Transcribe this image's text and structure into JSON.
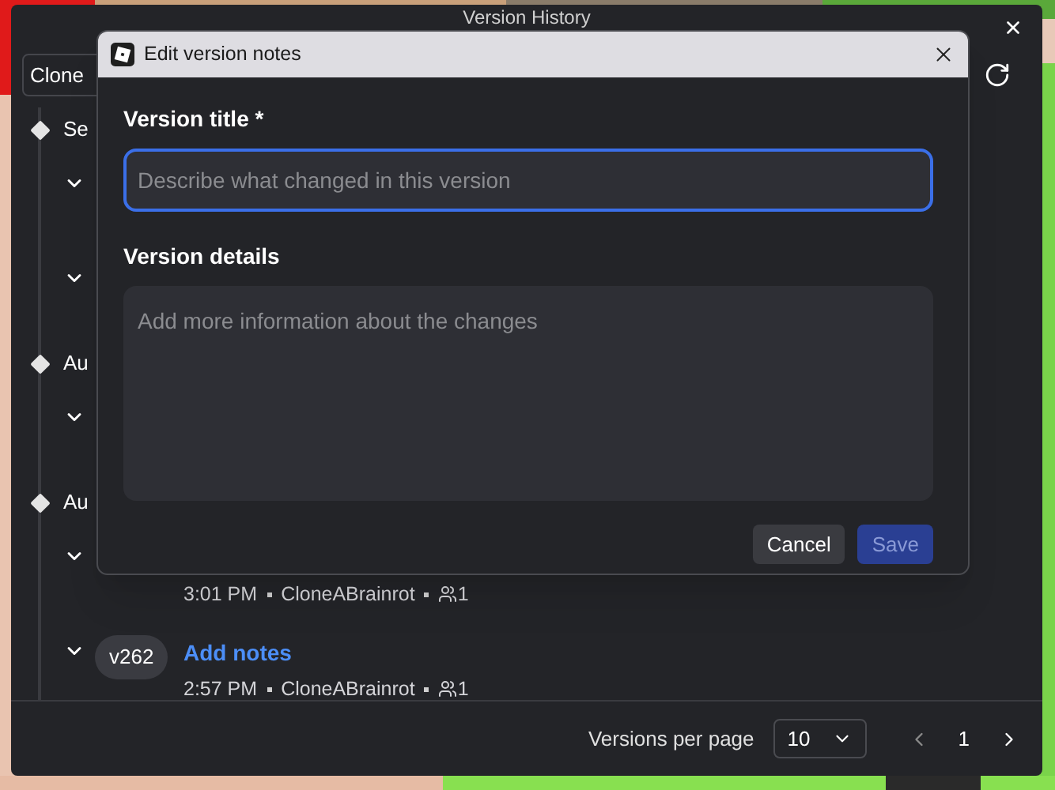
{
  "window": {
    "title": "Version History"
  },
  "toolbar": {
    "dropdown_value": "Clone"
  },
  "timeline": [
    {
      "label": "Se",
      "versions": [
        {
          "expanded": false
        },
        {
          "expanded": false
        }
      ]
    },
    {
      "label": "Au",
      "versions": [
        {
          "expanded": false
        }
      ]
    },
    {
      "label": "Au",
      "versions": [
        {
          "expanded": false,
          "time": "3:01 PM",
          "author": "CloneABrainrot",
          "collaborators": "1"
        },
        {
          "expanded": false,
          "badge": "v262",
          "notes_link": "Add notes",
          "time": "2:57 PM",
          "author": "CloneABrainrot",
          "collaborators": "1"
        }
      ]
    }
  ],
  "footer": {
    "per_page_label": "Versions per page",
    "per_page_value": "10",
    "page": "1"
  },
  "dialog": {
    "title": "Edit version notes",
    "fields": [
      {
        "kind": "input",
        "label": "Version title *",
        "placeholder": "Describe what changed in this version",
        "focused": true
      },
      {
        "kind": "textarea",
        "label": "Version details",
        "placeholder": "Add more information about the changes",
        "focused": false
      }
    ],
    "buttons": [
      {
        "label": "Cancel",
        "kind": "secondary",
        "disabled": false
      },
      {
        "label": "Save",
        "kind": "primary",
        "disabled": true
      }
    ]
  }
}
